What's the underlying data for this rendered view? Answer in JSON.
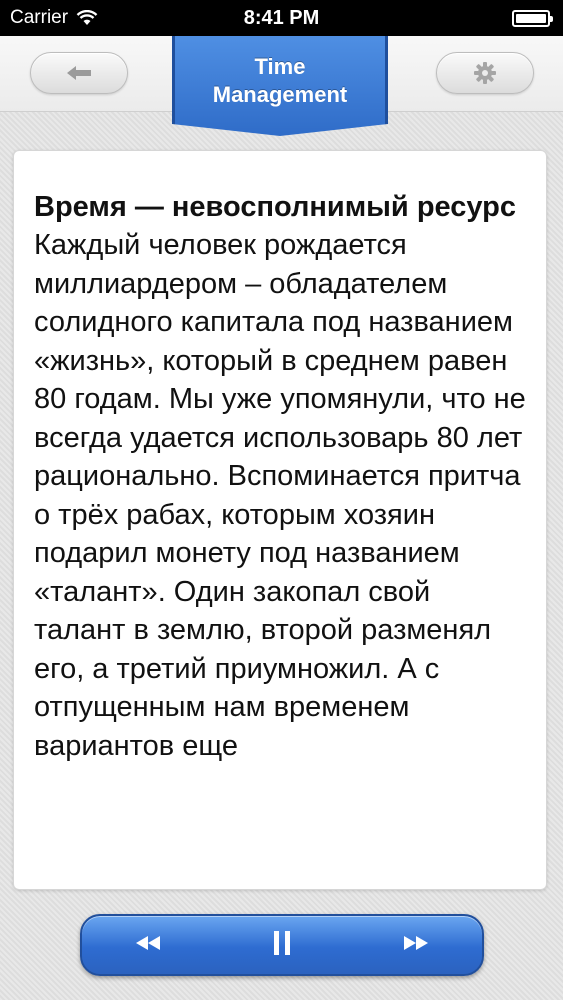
{
  "status_bar": {
    "carrier": "Carrier",
    "time": "8:41 PM"
  },
  "nav": {
    "title": "Time\nManagement",
    "back_icon": "left-arrow-icon",
    "settings_icon": "gear-icon"
  },
  "article": {
    "title": "Время — невосполнимый ресурс",
    "body": "Каждый человек рождается миллиардером – обладателем солидного капитала под названием «жизнь», который в среднем равен 80 годам. Мы уже упомянули, что не всегда удается использоварь 80 лет рационально. Вспоминается притча о трёх рабах, которым хозяин подарил монету под названием «талант». Один закопал свой талант в землю, второй разменял его, а третий приумножил. А с отпущенным нам временем вариантов еще"
  },
  "player": {
    "rewind_icon": "rewind-icon",
    "pause_icon": "pause-icon",
    "forward_icon": "fast-forward-icon"
  },
  "colors": {
    "accent_blue": "#3a78d6",
    "ribbon_border": "#1f4f9d"
  }
}
